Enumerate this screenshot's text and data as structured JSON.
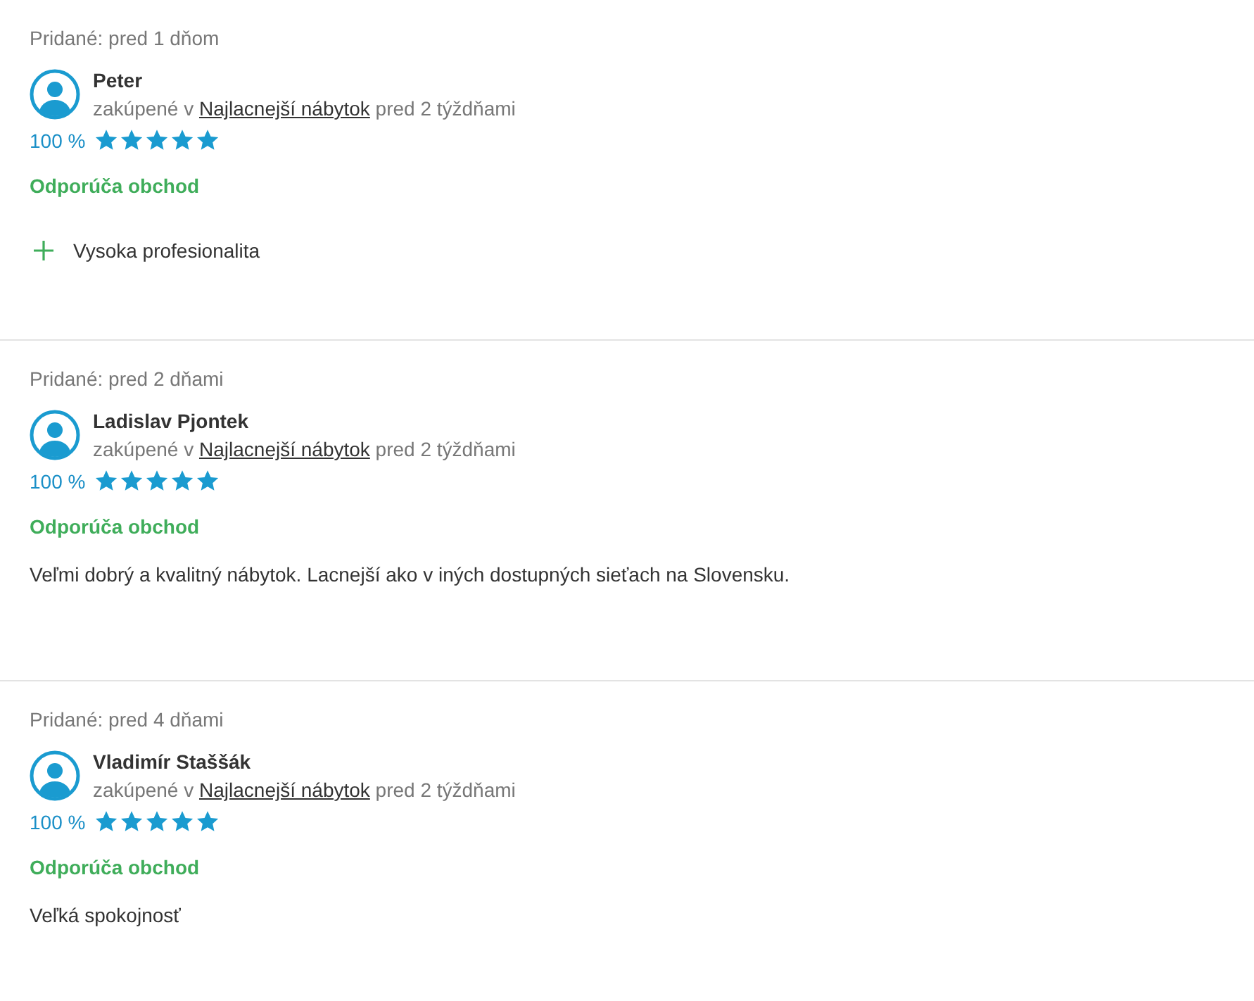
{
  "reviews": [
    {
      "added": "Pridané: pred 1 dňom",
      "author": "Peter",
      "purchase_prefix": "zakúpené v",
      "shop": "Najlacnejší nábytok",
      "purchase_suffix": "pred 2 týždňami",
      "rating": "100 %",
      "stars": 5,
      "recommendation": "Odporúča obchod",
      "pros": [
        "Vysoka profesionalita"
      ]
    },
    {
      "added": "Pridané: pred 2 dňami",
      "author": "Ladislav Pjontek",
      "purchase_prefix": "zakúpené v",
      "shop": "Najlacnejší nábytok",
      "purchase_suffix": "pred 2 týždňami",
      "rating": "100 %",
      "stars": 5,
      "recommendation": "Odporúča obchod",
      "text": "Veľmi dobrý a kvalitný nábytok. Lacnejší ako v iných dostupných sieťach na Slovensku."
    },
    {
      "added": "Pridané: pred 4 dňami",
      "author": "Vladimír Staššák",
      "purchase_prefix": "zakúpené v",
      "shop": "Najlacnejší nábytok",
      "purchase_suffix": "pred 2 týždňami",
      "rating": "100 %",
      "stars": 5,
      "recommendation": "Odporúča obchod",
      "text": "Veľká spokojnosť"
    }
  ]
}
